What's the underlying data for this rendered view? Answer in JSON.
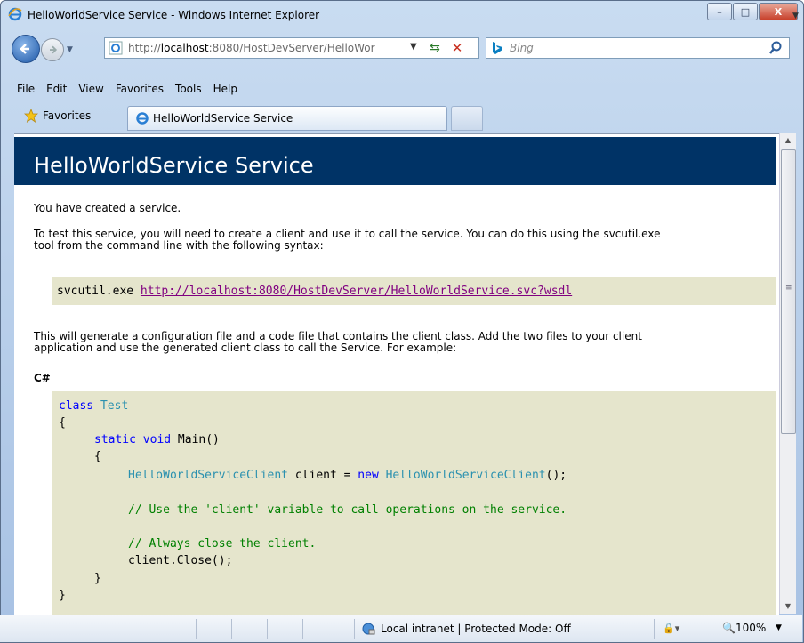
{
  "window": {
    "title": "HelloWorldService Service - Windows Internet Explorer",
    "controls": {
      "minimize": "–",
      "maximize": "□",
      "close": "X"
    }
  },
  "nav": {
    "address_prefix": "http://",
    "address_host": "localhost",
    "address_rest": ":8080/HostDevServer/HelloWor",
    "search_placeholder": "Bing"
  },
  "menu": [
    "File",
    "Edit",
    "View",
    "Favorites",
    "Tools",
    "Help"
  ],
  "favorites": {
    "button_label": "Favorites",
    "tab_label": "HelloWorldService Service"
  },
  "page": {
    "title": "HelloWorldService Service",
    "intro": "You have created a service.",
    "test_line1": "To test this service, you will need to create a client and use it to call the service. You can do this using the svcutil.exe",
    "test_line2": "tool from the command line with the following syntax:",
    "cmd_prefix": "svcutil.exe ",
    "cmd_link": "http://localhost:8080/HostDevServer/HelloWorldService.svc?wsdl",
    "gen_line1": "This will generate a configuration file and a code file that contains the client class. Add the two files to your client",
    "gen_line2": "application and use the generated client class to call the Service. For example:",
    "lang_label": "C#",
    "code": {
      "l1_kw": "class",
      "l1_ty": "Test",
      "l2": "{",
      "l3_kw": "static void",
      "l3_rest": " Main()",
      "l4": "{",
      "l5_ty1": "HelloWorldServiceClient",
      "l5_mid": " client = ",
      "l5_kw": "new",
      "l5_ty2": "HelloWorldServiceClient",
      "l5_end": "();",
      "l6_cm": "// Use the 'client' variable to call operations on the service.",
      "l7_cm": "// Always close the client.",
      "l8": "client.Close();",
      "l9": "}",
      "l10": "}"
    }
  },
  "status": {
    "zone": "Local intranet | Protected Mode: Off",
    "zoom": "100%"
  },
  "colors": {
    "header_bg": "#003366",
    "code_bg": "#e5e5cc",
    "keyword": "#0000ff",
    "type": "#2b91af",
    "comment": "#008000",
    "visited_link": "#800080"
  }
}
